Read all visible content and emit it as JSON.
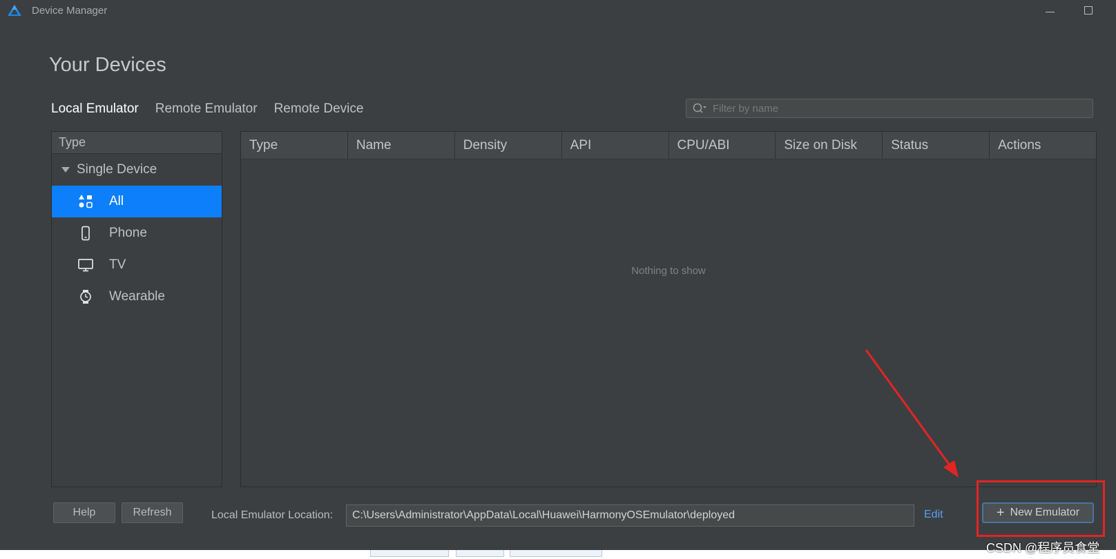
{
  "window": {
    "title": "Device Manager"
  },
  "page": {
    "heading": "Your Devices"
  },
  "tabs": [
    {
      "label": "Local Emulator",
      "active": true
    },
    {
      "label": "Remote Emulator",
      "active": false
    },
    {
      "label": "Remote Device",
      "active": false
    }
  ],
  "filter": {
    "placeholder": "Filter by name",
    "icon": "search-icon"
  },
  "sidebar": {
    "header": "Type",
    "group": {
      "label": "Single Device",
      "expanded": true
    },
    "items": [
      {
        "label": "All",
        "icon": "grid-icon",
        "selected": true
      },
      {
        "label": "Phone",
        "icon": "phone-icon",
        "selected": false
      },
      {
        "label": "TV",
        "icon": "tv-icon",
        "selected": false
      },
      {
        "label": "Wearable",
        "icon": "watch-icon",
        "selected": false
      }
    ]
  },
  "table": {
    "columns": [
      "Type",
      "Name",
      "Density",
      "API",
      "CPU/ABI",
      "Size on Disk",
      "Status",
      "Actions"
    ],
    "rows": [],
    "empty_text": "Nothing to show"
  },
  "footer": {
    "help_label": "Help",
    "refresh_label": "Refresh",
    "location_label": "Local Emulator Location:",
    "location_value": "C:\\Users\\Administrator\\AppData\\Local\\Huawei\\HarmonyOSEmulator\\deployed",
    "edit_label": "Edit",
    "new_emulator_label": "New Emulator"
  },
  "watermark": "CSDN @程序员食堂",
  "colors": {
    "background": "#3c3f41",
    "selection": "#0d7ffb",
    "link": "#589df6",
    "annotation": "#e32424"
  }
}
